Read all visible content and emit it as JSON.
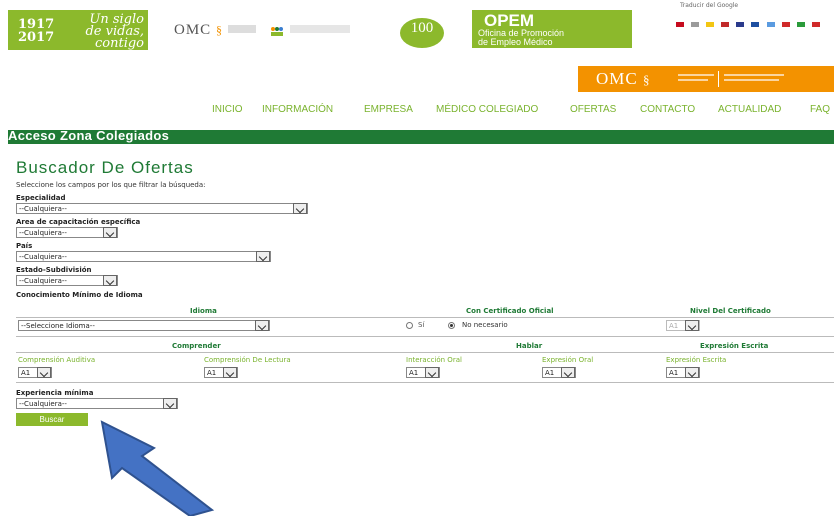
{
  "header": {
    "anniversary_years": [
      "1917",
      "2017"
    ],
    "motto_lines": [
      "Un siglo",
      "de vidas,",
      "contigo"
    ],
    "omc_logo": "OMC",
    "centenary": "100",
    "opem_title": "OPEM",
    "opem_subtitle_lines": [
      "Oficina de Promoción",
      "de Empleo Médico"
    ],
    "orange_logo": "OMC",
    "translate_label": "Traducir del Google",
    "brand_green": "#8cb92c",
    "brand_dark_green": "#1f7a35",
    "brand_orange": "#f39200"
  },
  "nav": {
    "items": [
      "INICIO",
      "INFORMACIÓN",
      "EMPRESA",
      "MÉDICO COLEGIADO",
      "OFERTAS",
      "CONTACTO",
      "ACTUALIDAD",
      "FAQ"
    ]
  },
  "section_band": "Acceso Zona Colegiados",
  "page_title": "Buscador De Ofertas",
  "lead_text": "Seleccione los campos por los que filtrar la búsqueda:",
  "filters": {
    "especialidad_label": "Especialidad",
    "especialidad_value": "--Cualquiera--",
    "area_label": "Area de capacitación específica",
    "area_value": "--Cualquiera--",
    "pais_label": "País",
    "pais_value": "--Cualquiera--",
    "estado_label": "Estado-Subdivisión",
    "estado_value": "--Cualquiera--",
    "idioma_section_label": "Conocimiento Mínimo de Idioma"
  },
  "language_table": {
    "col_idioma": "Idioma",
    "col_certificado": "Con Certificado Oficial",
    "col_nivel": "Nivel Del Certificado",
    "idioma_value": "--Seleccione Idioma--",
    "radio_si": "Sí",
    "radio_no": "No necesario",
    "nivel_value": "A1",
    "group_comprender": "Comprender",
    "group_hablar": "Hablar",
    "group_escrita": "Expresión Escrita",
    "sub_auditiva": "Comprensión Auditiva",
    "sub_lectura": "Comprensión De Lectura",
    "sub_interaccion": "Interacción Oral",
    "sub_expresion_oral": "Expresión Oral",
    "sub_expresion_escrita": "Expresión Escrita",
    "level_values": [
      "A1",
      "A1",
      "A1",
      "A1",
      "A1"
    ]
  },
  "experiencia": {
    "label": "Experiencia mínima",
    "value": "--Cualquiera--"
  },
  "search_button": "Buscar"
}
